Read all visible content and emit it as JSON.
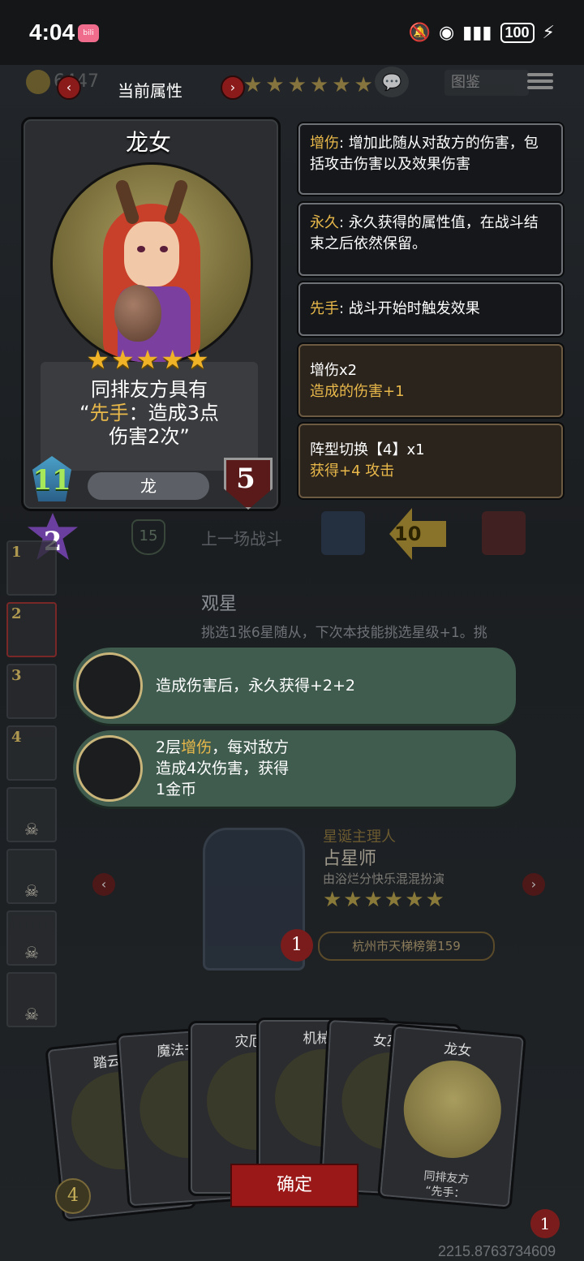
{
  "status": {
    "time": "4:04",
    "app_badge": "bilibili",
    "battery": "100"
  },
  "top": {
    "gold": "6447",
    "title": "当前属性",
    "stars": "★★★★★★",
    "codex": "图鉴"
  },
  "card": {
    "name": "龙女",
    "stars": "★★★★★",
    "desc_line1": "同排友方具有",
    "desc_quote_open": "“",
    "desc_keyword": "先手",
    "desc_line2_rest": "：造成3点",
    "desc_line3": "伤害2次”",
    "tribe": "龙",
    "attack": "11",
    "health": "5"
  },
  "keywords": [
    {
      "key": "增伤",
      "text": ": 增加此随从对敌方的伤害，包括攻击伤害以及效果伤害"
    },
    {
      "key": "永久",
      "text": ": 永久获得的属性值，在战斗结束之后依然保留。"
    },
    {
      "key": "先手",
      "text": ": 战斗开始时触发效果"
    }
  ],
  "buffs": [
    {
      "title": "增伤x2",
      "sub": "造成的伤害+1"
    },
    {
      "title": "阵型切换【4】x1",
      "sub": "获得+4 攻击"
    }
  ],
  "middle": {
    "level": "2",
    "shield": "15",
    "last_battle": "上一场战斗",
    "badge": "10",
    "skill_title": "观星",
    "skill_text": "挑选1张6星随从，下次本技能挑选星级+1。挑"
  },
  "roster": [
    "1",
    "2",
    "3",
    "4"
  ],
  "tooltips": [
    {
      "text": "造成伤害后，永久获得+2+2"
    },
    {
      "pre": "2层",
      "key": "增伤",
      "post1": "，每对敌方",
      "line2": "造成4次伤害，获得",
      "line3": "1金币"
    }
  ],
  "opponent": {
    "title": "星诞主理人",
    "name": "占星师",
    "sub": "由浴烂分快乐混混扮演",
    "stars": "★★★★★★",
    "health": "1",
    "rank": "杭州市天梯榜第159"
  },
  "hand": [
    {
      "name": "踏云祥"
    },
    {
      "name": "魔法书页"
    },
    {
      "name": "灾厄巨"
    },
    {
      "name": "机械降"
    },
    {
      "name": "女巫坩"
    },
    {
      "name": "龙女",
      "desc": "同排友方",
      "desc2": "“先手："
    }
  ],
  "bottom": {
    "confirm": "确定",
    "coin": "4",
    "heart": "1",
    "coords": "2215.8763734609"
  },
  "colors": {
    "accent": "#e8b84a",
    "confirm": "#9a1818",
    "pill": "#3f5c4f",
    "attack_text": "#a6e85a"
  }
}
